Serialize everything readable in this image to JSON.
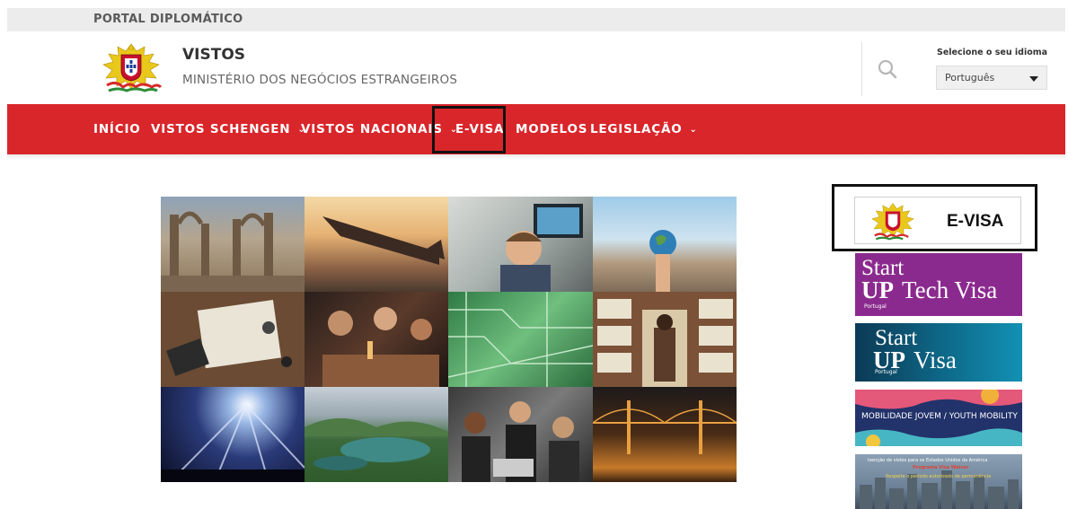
{
  "topbar": {
    "title": "PORTAL DIPLOMÁTICO"
  },
  "header": {
    "title": "VISTOS",
    "subtitle": "MINISTÉRIO DOS NEGÓCIOS ESTRANGEIROS",
    "logo_icon": "portugal-coat-of-arms",
    "search_icon": "search-icon",
    "language": {
      "label": "Selecione o seu idioma",
      "selected": "Português"
    }
  },
  "nav": {
    "items": [
      {
        "label": "INÍCIO",
        "dropdown": false
      },
      {
        "label": "VISTOS SCHENGEN",
        "dropdown": true
      },
      {
        "label": "VISTOS NACIONAIS",
        "dropdown": true
      },
      {
        "label": "E-VISA",
        "dropdown": false,
        "highlighted": true
      },
      {
        "label": "MODELOS",
        "dropdown": false
      },
      {
        "label": "LEGISLAÇÃO",
        "dropdown": true
      }
    ],
    "bg_color": "#d9262b"
  },
  "collage": {
    "tiles": [
      "ruined-church",
      "airplane-wing-sunset",
      "man-at-computer",
      "hand-holding-globe",
      "map-and-laptop",
      "friends-at-table",
      "circuit-board",
      "library-bookshelves",
      "concert-lights",
      "green-lake-landscape",
      "business-meeting",
      "bridge-at-night"
    ]
  },
  "sidebar": {
    "evisa": {
      "label": "E-VISA"
    },
    "startup_tech": {
      "line1": "Start",
      "line2_bold": "UP",
      "line2_rest": "Tech Visa",
      "small": "Portugal"
    },
    "startup": {
      "line1": "Start",
      "line2_bold": "UP",
      "line2_rest": "Visa",
      "small": "Portugal"
    },
    "youth": {
      "label": "MOBILIDADE JOVEM / YOUTH MOBILITY"
    },
    "us_waiver": {
      "line1": "Isenção de vistos para os Estados Unidos da América",
      "line2": "Programa Visa Waiver",
      "line3": "Respeite o período autorizado de permanência"
    }
  }
}
